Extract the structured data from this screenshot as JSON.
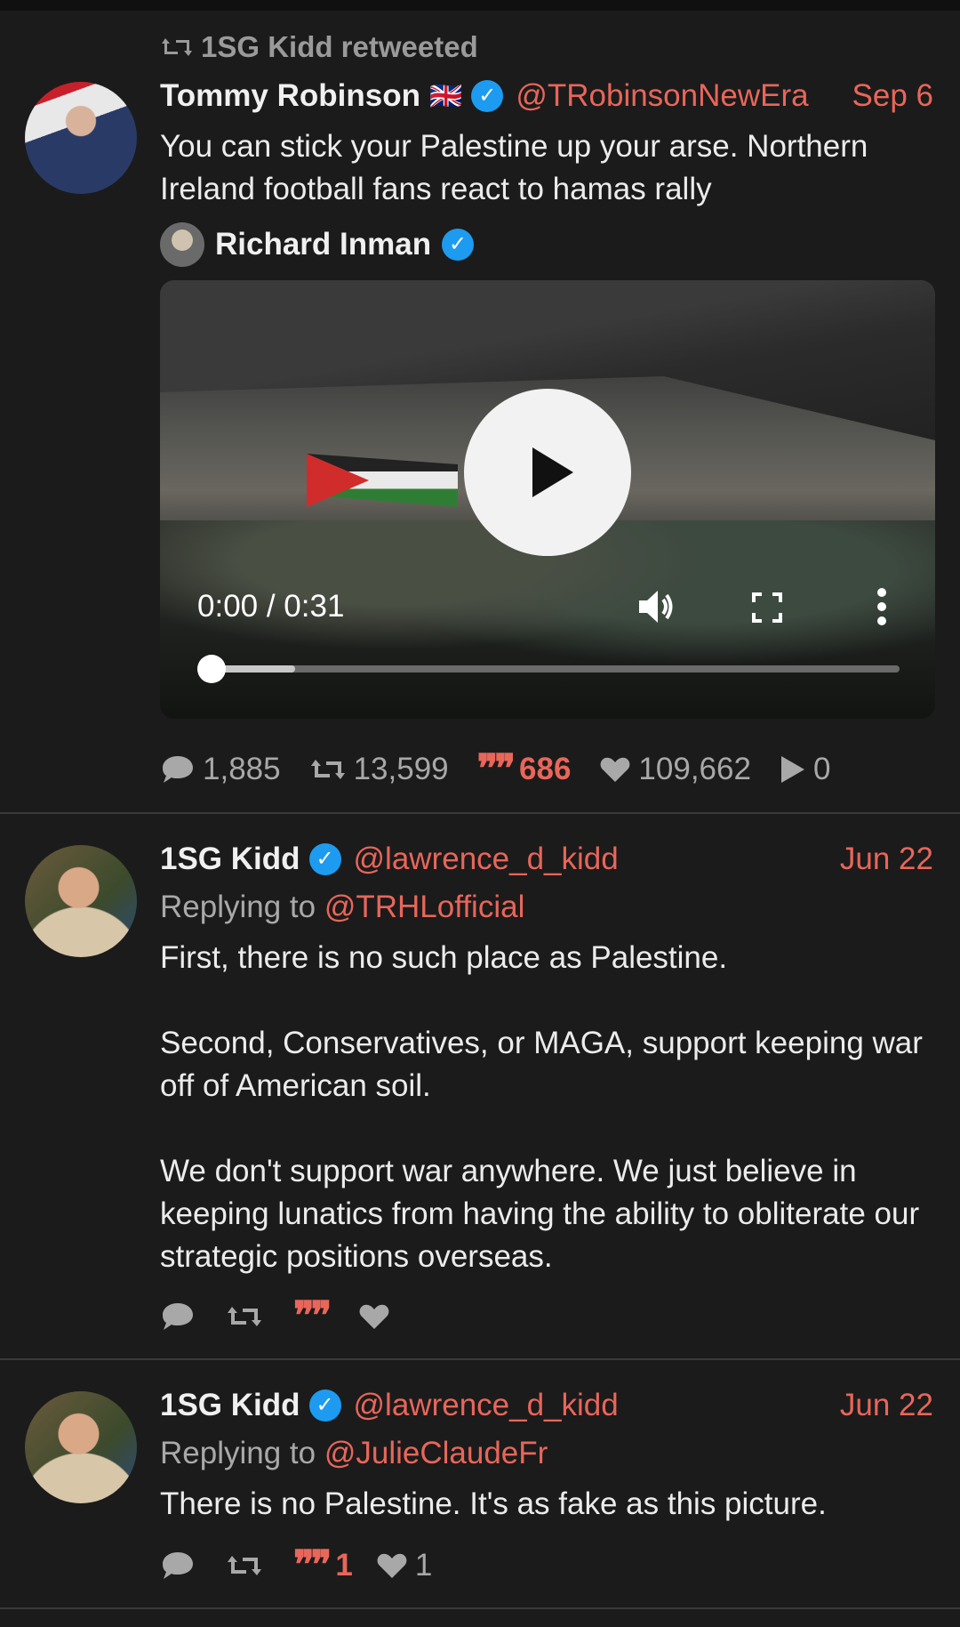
{
  "tweets": [
    {
      "retweeted_by": "1SG Kidd retweeted",
      "author": {
        "name": "Tommy Robinson",
        "flag": "🇬🇧",
        "handle": "@TRobinsonNewEra"
      },
      "date": "Sep 6",
      "text": "You can stick your Palestine up your arse. Northern Ireland football fans react to hamas rally",
      "quoted_author": "Richard Inman",
      "video": {
        "time": "0:00 / 0:31",
        "progress": 0.0
      },
      "stats": {
        "replies": "1,885",
        "retweets": "13,599",
        "quotes": "686",
        "likes": "109,662",
        "plays": "0"
      }
    },
    {
      "author": {
        "name": "1SG Kidd",
        "handle": "@lawrence_d_kidd"
      },
      "date": "Jun 22",
      "replying_label": "Replying to",
      "replying_to": "@TRHLofficial",
      "text": "First, there is no such place as Palestine.\n\nSecond, Conservatives, or MAGA, support keeping war off of American soil.\n\nWe don't support war anywhere. We just believe in keeping lunatics from having the ability to obliterate our strategic positions overseas.",
      "stats": {
        "replies": "",
        "retweets": "",
        "quotes": "",
        "likes": ""
      }
    },
    {
      "author": {
        "name": "1SG Kidd",
        "handle": "@lawrence_d_kidd"
      },
      "date": "Jun 22",
      "replying_label": "Replying to",
      "replying_to": "@JulieClaudeFr",
      "text": "There is no Palestine. It's as fake as this picture.",
      "stats": {
        "replies": "",
        "retweets": "",
        "quotes": "1",
        "likes": "1"
      }
    }
  ],
  "colors": {
    "accent": "#e8665a",
    "verified": "#1d9bf0",
    "background": "#1b1b1b"
  }
}
